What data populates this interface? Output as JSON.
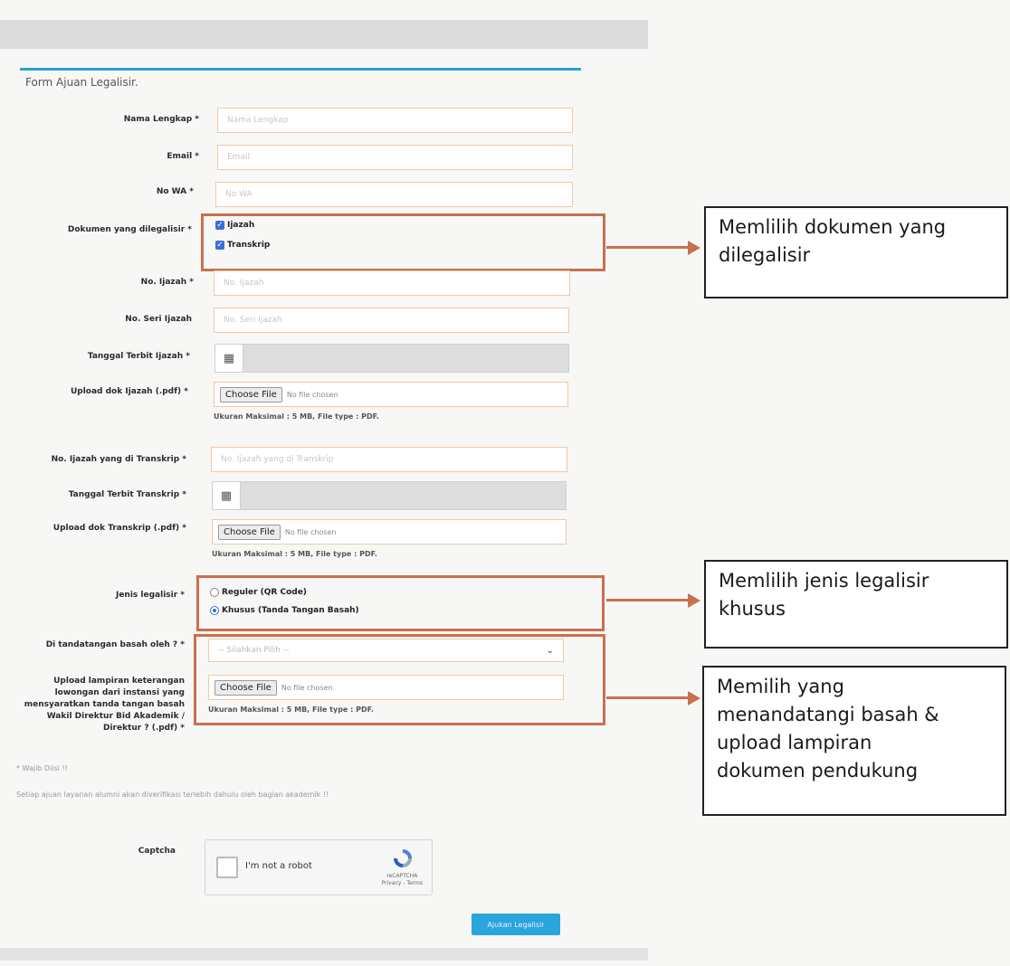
{
  "form": {
    "title": "Form Ajuan Legalisir.",
    "fields": {
      "nama": {
        "label": "Nama Lengkap *",
        "placeholder": "Nama Lengkap"
      },
      "email": {
        "label": "Email *",
        "placeholder": "Email"
      },
      "wa": {
        "label": "No WA *",
        "placeholder": "No WA"
      },
      "dokumen": {
        "label": "Dokumen yang dilegalisir *",
        "options": [
          "Ijazah",
          "Transkrip"
        ]
      },
      "no_ijazah": {
        "label": "No. Ijazah *",
        "placeholder": "No. Ijazah"
      },
      "seri_ijazah": {
        "label": "No. Seri Ijazah",
        "placeholder": "No. Seri Ijazah"
      },
      "tgl_ijazah": {
        "label": "Tanggal Terbit Ijazah *"
      },
      "upload_ijazah": {
        "label": "Upload dok Ijazah (.pdf) *",
        "button": "Choose File",
        "status": "No file chosen",
        "hint": "Ukuran Maksimal : 5 MB, File type : PDF."
      },
      "no_transkrip": {
        "label": "No. Ijazah yang di Transkrip *",
        "placeholder": "No. Ijazah yang di Transkrip"
      },
      "tgl_transkrip": {
        "label": "Tanggal Terbit Transkrip *"
      },
      "upload_transkrip": {
        "label": "Upload dok Transkrip (.pdf) *",
        "button": "Choose File",
        "status": "No file chosen",
        "hint": "Ukuran Maksimal : 5 MB, File type : PDF."
      },
      "jenis": {
        "label": "Jenis legalisir *",
        "options": [
          "Reguler (QR Code)",
          "Khusus (Tanda Tangan Basah)"
        ],
        "selected": "Khusus (Tanda Tangan Basah)"
      },
      "ttd": {
        "label": "Di tandatangan basah oleh ? *",
        "value": "-- Silahkan Pilih --"
      },
      "lampiran": {
        "label_lines": [
          "Upload lampiran keterangan",
          "lowongan dari instansi yang",
          "mensyaratkan tanda tangan basah",
          "Wakil Direktur Bid Akademik /",
          "Direktur ? (.pdf) *"
        ],
        "button": "Choose File",
        "status": "No file chosen",
        "hint": "Ukuran Maksimal : 5 MB, File type : PDF."
      }
    },
    "required_note": "* Wajib Diisi !!",
    "info_note": "Setiap ajuan layanan alumni akan diverifikasi terlebih dahulu oleh bagian akademik !!",
    "captcha": {
      "label": "Captcha",
      "text": "I'm not a robot",
      "brand": "reCAPTCHA",
      "links": "Privacy - Terms"
    },
    "submit": "Ajukan Legalisir"
  },
  "callouts": {
    "dokumen": [
      "Memlilih dokumen yang",
      "dilegalisir"
    ],
    "jenis": [
      "Memlilih jenis legalisir",
      "khusus"
    ],
    "lampiran": [
      "Memilih yang",
      "menandatangi basah &",
      "upload lampiran",
      "dokumen pendukung"
    ]
  },
  "colors": {
    "accent": "#2aa1d0",
    "annotation": "#c9704d",
    "checkbox": "#3a6fd8"
  }
}
